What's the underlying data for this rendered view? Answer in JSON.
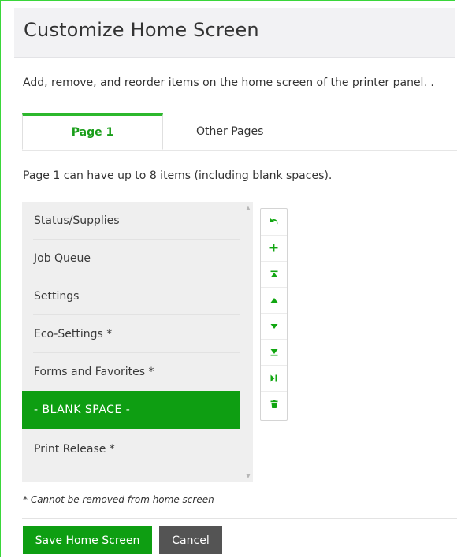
{
  "page": {
    "title": "Customize Home Screen",
    "description": "Add, remove, and reorder items on the home screen of the printer panel. ."
  },
  "tabs": [
    {
      "label": "Page 1",
      "active": true
    },
    {
      "label": "Other Pages",
      "active": false
    }
  ],
  "limit_text": "Page 1 can have up to 8 items (including blank spaces).",
  "items": [
    {
      "label": "Status/Supplies",
      "selected": false
    },
    {
      "label": "Job Queue",
      "selected": false
    },
    {
      "label": "Settings",
      "selected": false
    },
    {
      "label": "Eco-Settings *",
      "selected": false
    },
    {
      "label": "Forms and Favorites *",
      "selected": false
    },
    {
      "label": "- BLANK SPACE -",
      "selected": true
    },
    {
      "label": "Print Release *",
      "selected": false
    }
  ],
  "toolbar": [
    {
      "icon": "undo-icon",
      "action": "undo"
    },
    {
      "icon": "plus-icon",
      "action": "add"
    },
    {
      "icon": "move-to-top-icon",
      "action": "move-top"
    },
    {
      "icon": "move-up-icon",
      "action": "move-up"
    },
    {
      "icon": "move-down-icon",
      "action": "move-down"
    },
    {
      "icon": "move-to-bottom-icon",
      "action": "move-bottom"
    },
    {
      "icon": "move-to-next-page-icon",
      "action": "next-page"
    },
    {
      "icon": "trash-icon",
      "action": "delete"
    }
  ],
  "note": "* Cannot be removed from home screen",
  "buttons": {
    "save": "Save Home Screen",
    "cancel": "Cancel"
  },
  "colors": {
    "accent": "#0e9e12",
    "tab_active_text": "#1a9e1a",
    "cancel": "#545454",
    "frame_border": "#3ad63a"
  }
}
